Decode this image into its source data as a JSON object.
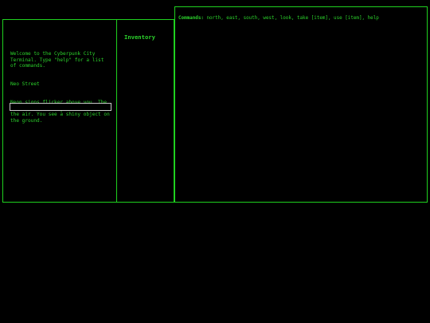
{
  "terminal": {
    "lines": [
      "Welcome to the Cyberpunk City Terminal. Type \"help\" for a list of commands.",
      "Neo Street",
      "Neon signs flicker above you. The sound of distant gunfire echoes in the air. You see a shiny object on the ground."
    ],
    "input_value": ""
  },
  "inventory": {
    "title": "Inventory",
    "items": []
  },
  "commands": {
    "label": "Commands:",
    "list": "north, east, south, west, look, take [item], use [item], help"
  },
  "colors": {
    "background": "#000000",
    "accent": "#2bd12b",
    "border": "#1fd11f"
  }
}
